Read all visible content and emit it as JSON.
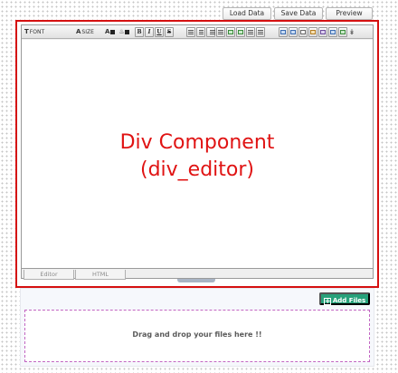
{
  "top_buttons": {
    "load": "Load Data",
    "save": "Save Data",
    "preview": "Preview"
  },
  "toolbar": {
    "font_label": "FONT",
    "size_label": "SIZE",
    "size_prefix": "A",
    "bold": "B",
    "italic": "I",
    "underline": "U",
    "strike": "S",
    "expand_icon": "chevron-double-down-icon"
  },
  "editor": {
    "caption_line1": "Div Component",
    "caption_line2": "(div_editor)",
    "caption_color": "#e01313",
    "border_color": "#d51010",
    "tabs": [
      {
        "label": "Editor"
      },
      {
        "label": "HTML"
      }
    ]
  },
  "upload": {
    "add_files": "Add Files",
    "add_files_color": "#27a17a",
    "dropzone_text": "Drag and drop your files here !!"
  }
}
